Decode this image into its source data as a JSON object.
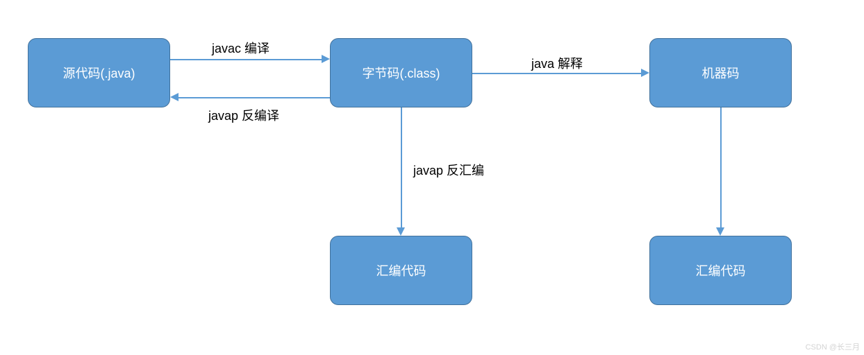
{
  "nodes": {
    "source": {
      "label": "源代码(.java)"
    },
    "bytecode": {
      "label": "字节码(.class)"
    },
    "machine": {
      "label": "机器码"
    },
    "asm1": {
      "label": "汇编代码"
    },
    "asm2": {
      "label": "汇编代码"
    }
  },
  "edges": {
    "javac": {
      "label": "javac 编译"
    },
    "javap_de": {
      "label": "javap 反编译"
    },
    "java_int": {
      "label": "java 解释"
    },
    "javap_dis": {
      "label": "javap 反汇编"
    }
  },
  "watermark": "CSDN @长三月"
}
